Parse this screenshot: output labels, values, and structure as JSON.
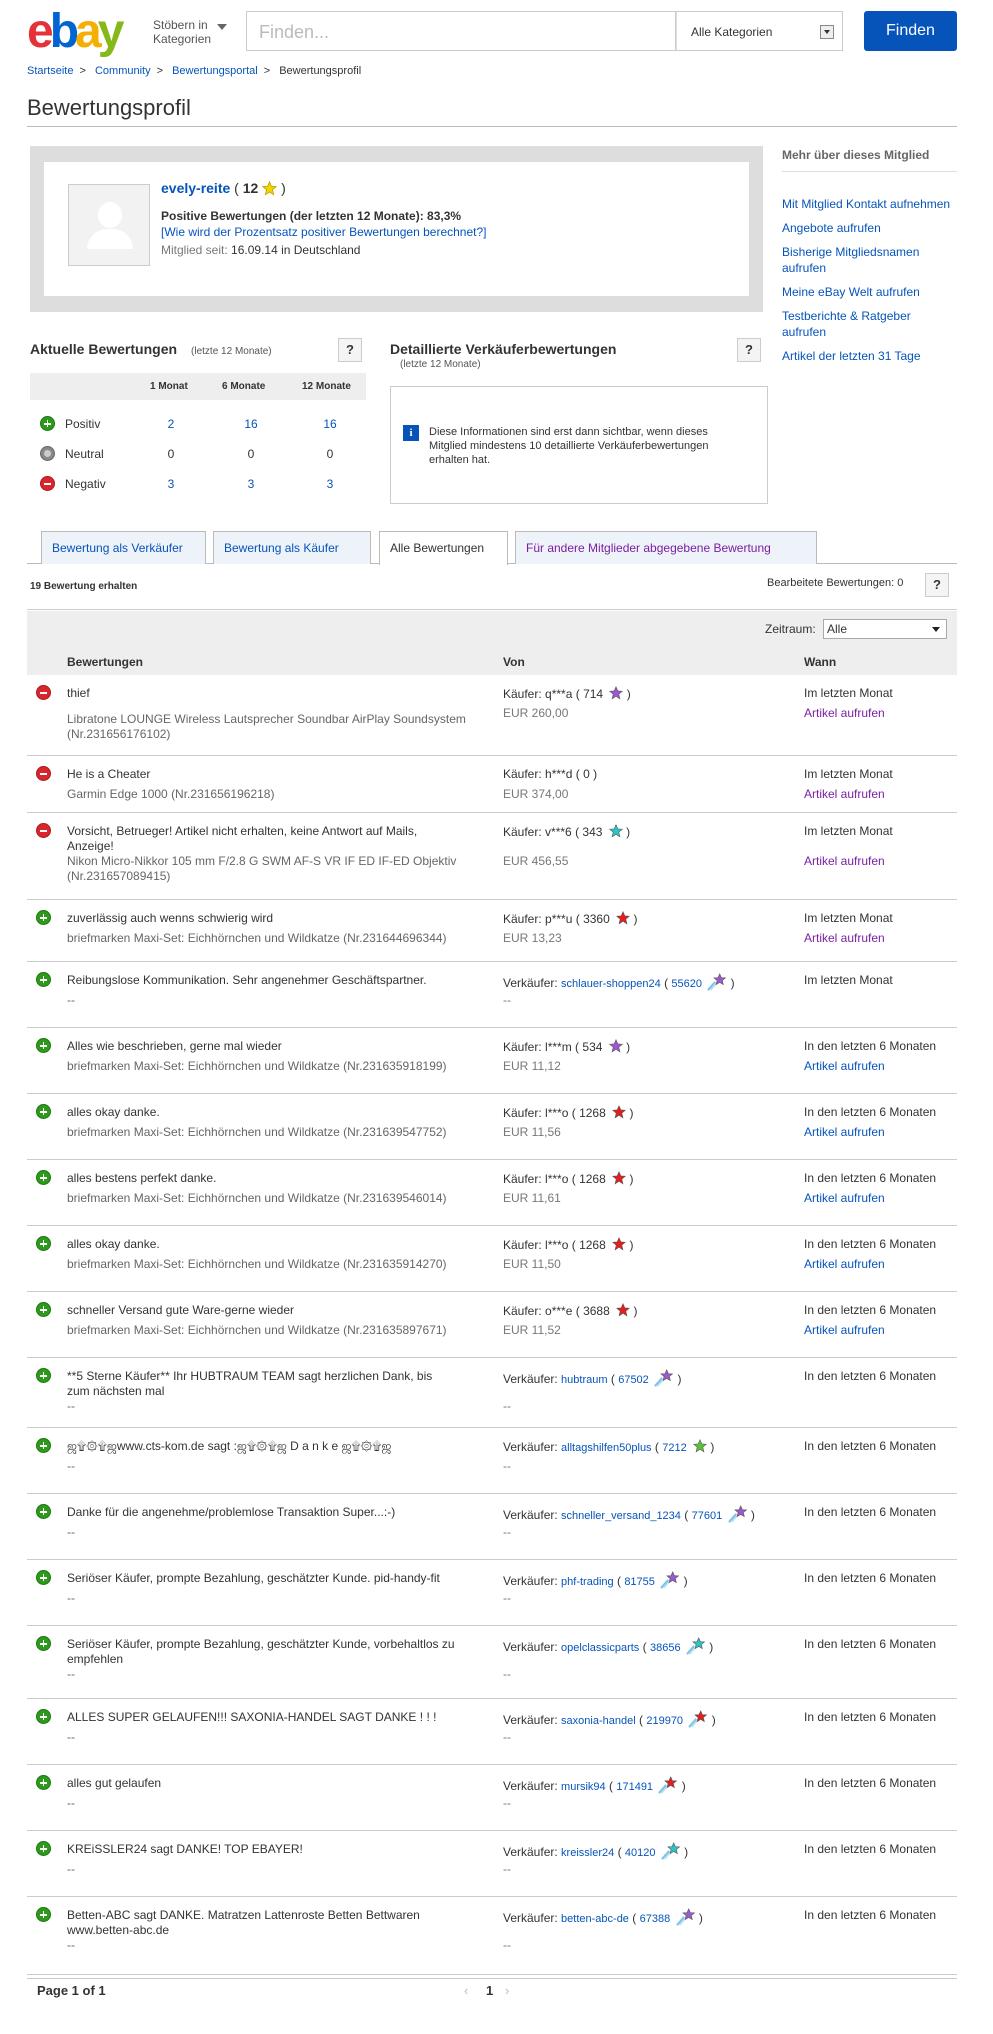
{
  "header": {
    "logo_letters": [
      "e",
      "b",
      "a",
      "y"
    ],
    "browse_line1": "Stöbern in",
    "browse_line2": "Kategorien",
    "search_placeholder": "Finden...",
    "category_select": "Alle Kategorien",
    "find_button": "Finden"
  },
  "breadcrumb": [
    "Startseite",
    "Community",
    "Bewertungsportal",
    "Bewertungsprofil"
  ],
  "page_title": "Bewertungsprofil",
  "profile": {
    "username": "evely-reite",
    "score": "12",
    "star_color": "#f5d300",
    "positive_line": "Positive Bewertungen (der letzten 12 Monate): 83,3%",
    "how_link": "[Wie wird der Prozentsatz positiver Bewertungen berechnet?]",
    "member_since_label": "Mitglied seit:",
    "member_since_value": "16.09.14 in Deutschland"
  },
  "sidebar": {
    "title": "Mehr über dieses Mitglied",
    "links": [
      "Mit Mitglied Kontakt aufnehmen",
      "Angebote aufrufen",
      "Bisherige Mitgliedsnamen aufrufen",
      "Meine eBay Welt aufrufen",
      "Testberichte & Ratgeber aufrufen",
      "Artikel der letzten 31 Tage"
    ]
  },
  "recent": {
    "title": "Aktuelle Bewertungen",
    "subtitle": "(letzte 12 Monate)",
    "help": "?",
    "columns": [
      "1 Monat",
      "6 Monate",
      "12 Monate"
    ],
    "rows": [
      {
        "label": "Positiv",
        "type": "pos",
        "values": [
          "2",
          "16",
          "16"
        ],
        "link": true
      },
      {
        "label": "Neutral",
        "type": "neu",
        "values": [
          "0",
          "0",
          "0"
        ],
        "link": false
      },
      {
        "label": "Negativ",
        "type": "neg",
        "values": [
          "3",
          "3",
          "3"
        ],
        "link": true
      }
    ]
  },
  "detailed": {
    "title": "Detaillierte Verkäuferbewertungen",
    "subtitle": "(letzte 12 Monate)",
    "help": "?",
    "info_icon": "i",
    "message": "Diese Informationen sind erst dann sichtbar, wenn dieses Mitglied mindestens 10 detaillierte Verkäuferbewertungen erhalten hat."
  },
  "tabs": [
    "Bewertung als Verkäufer",
    "Bewertung als Käufer",
    "Alle Bewertungen",
    "Für andere Mitglieder abgegebene Bewertung"
  ],
  "active_tab": "Alle Bewertungen",
  "received_count": "19 Bewertung erhalten",
  "edited": "Bearbeitete Bewertungen: 0",
  "edited_help": "?",
  "timeframe_label": "Zeitraum:",
  "timeframe_value": "Alle",
  "table_headers": [
    "Bewertungen",
    "Von",
    "Wann"
  ],
  "feedback": [
    {
      "type": "neg",
      "comment": "thief",
      "item": "Libratone LOUNGE Wireless Lautsprecher Soundbar AirPlay Soundsystem (Nr.231656176102)",
      "role": "Käufer:",
      "user": "q***a",
      "score": "714",
      "star": "#9b59d0",
      "shooting": false,
      "price": "EUR 260,00",
      "when": "Im letzten Monat",
      "article": "Artikel aufrufen",
      "article_color": "purple"
    },
    {
      "type": "neg",
      "comment": "He is a Cheater",
      "item": "Garmin Edge 1000 (Nr.231656196218)",
      "role": "Käufer:",
      "user": "h***d",
      "score": "0",
      "star": "",
      "shooting": false,
      "price": "EUR 374,00",
      "when": "Im letzten Monat",
      "article": "Artikel aufrufen",
      "article_color": "purple"
    },
    {
      "type": "neg",
      "comment": "Vorsicht, Betrueger! Artikel nicht erhalten, keine Antwort auf Mails, Anzeige!",
      "item": "Nikon Micro-Nikkor 105 mm F/2.8 G SWM AF-S VR IF ED IF-ED Objektiv (Nr.231657089415)",
      "role": "Käufer:",
      "user": "v***6",
      "score": "343",
      "star": "#2cc3c3",
      "shooting": false,
      "price": "EUR 456,55",
      "when": "Im letzten Monat",
      "article": "Artikel aufrufen",
      "article_color": "purple"
    },
    {
      "type": "pos",
      "comment": "zuverlässig auch wenns schwierig wird",
      "item": "briefmarken Maxi-Set: Eichhörnchen und Wildkatze (Nr.231644696344)",
      "role": "Käufer:",
      "user": "p***u",
      "score": "3360",
      "star": "#e02020",
      "shooting": false,
      "price": "EUR 13,23",
      "when": "Im letzten Monat",
      "article": "Artikel aufrufen",
      "article_color": "purple"
    },
    {
      "type": "pos",
      "comment": "Reibungslose Kommunikation. Sehr angenehmer Geschäftspartner.",
      "item": "--",
      "role": "Verkäufer:",
      "user": "schlauer-shoppen24",
      "score": "55620",
      "star": "#9b59d0",
      "shooting": true,
      "price": "--",
      "when": "Im letzten Monat",
      "article": "",
      "article_color": "blue"
    },
    {
      "type": "pos",
      "comment": "Alles wie beschrieben, gerne mal wieder",
      "item": "briefmarken Maxi-Set: Eichhörnchen und Wildkatze (Nr.231635918199)",
      "role": "Käufer:",
      "user": "l***m",
      "score": "534",
      "star": "#9b59d0",
      "shooting": false,
      "price": "EUR 11,12",
      "when": "In den letzten 6 Monaten",
      "article": "Artikel aufrufen",
      "article_color": "blue"
    },
    {
      "type": "pos",
      "comment": "alles okay danke.",
      "item": "briefmarken Maxi-Set: Eichhörnchen und Wildkatze (Nr.231639547752)",
      "role": "Käufer:",
      "user": "l***o",
      "score": "1268",
      "star": "#e02020",
      "shooting": false,
      "price": "EUR 11,56",
      "when": "In den letzten 6 Monaten",
      "article": "Artikel aufrufen",
      "article_color": "blue"
    },
    {
      "type": "pos",
      "comment": "alles bestens perfekt danke.",
      "item": "briefmarken Maxi-Set: Eichhörnchen und Wildkatze (Nr.231639546014)",
      "role": "Käufer:",
      "user": "l***o",
      "score": "1268",
      "star": "#e02020",
      "shooting": false,
      "price": "EUR 11,61",
      "when": "In den letzten 6 Monaten",
      "article": "Artikel aufrufen",
      "article_color": "blue"
    },
    {
      "type": "pos",
      "comment": "alles okay danke.",
      "item": "briefmarken Maxi-Set: Eichhörnchen und Wildkatze (Nr.231635914270)",
      "role": "Käufer:",
      "user": "l***o",
      "score": "1268",
      "star": "#e02020",
      "shooting": false,
      "price": "EUR 11,50",
      "when": "In den letzten 6 Monaten",
      "article": "Artikel aufrufen",
      "article_color": "blue"
    },
    {
      "type": "pos",
      "comment": "schneller Versand gute Ware-gerne wieder",
      "item": "briefmarken Maxi-Set: Eichhörnchen und Wildkatze (Nr.231635897671)",
      "role": "Käufer:",
      "user": "o***e",
      "score": "3688",
      "star": "#e02020",
      "shooting": false,
      "price": "EUR 11,52",
      "when": "In den letzten 6 Monaten",
      "article": "Artikel aufrufen",
      "article_color": "blue"
    },
    {
      "type": "pos",
      "comment": "**5 Sterne Käufer** Ihr HUBTRAUM TEAM sagt herzlichen Dank, bis zum nächsten mal",
      "item": "--",
      "role": "Verkäufer:",
      "user": "hubtraum",
      "score": "67502",
      "star": "#9b59d0",
      "shooting": true,
      "price": "--",
      "when": "In den letzten 6 Monaten",
      "article": "",
      "article_color": "blue"
    },
    {
      "type": "pos",
      "comment": "ஜ۩۞۩ஜwww.cts-kom.de sagt :ஜ۩۞۩ஜ D a n k e ஜ۩۞۩ஜ",
      "item": "--",
      "role": "Verkäufer:",
      "user": "alltagshilfen50plus",
      "score": "7212",
      "star": "#5bc236",
      "shooting": false,
      "price": "--",
      "when": "In den letzten 6 Monaten",
      "article": "",
      "article_color": "blue"
    },
    {
      "type": "pos",
      "comment": "Danke für die angenehme/problemlose Transaktion Super...:-)",
      "item": "--",
      "role": "Verkäufer:",
      "user": "schneller_versand_1234",
      "score": "77601",
      "star": "#9b59d0",
      "shooting": true,
      "price": "--",
      "when": "In den letzten 6 Monaten",
      "article": "",
      "article_color": "blue"
    },
    {
      "type": "pos",
      "comment": "Seriöser Käufer, prompte Bezahlung, geschätzter Kunde. pid-handy-fit",
      "item": "--",
      "role": "Verkäufer:",
      "user": "phf-trading",
      "score": "81755",
      "star": "#9b59d0",
      "shooting": true,
      "price": "--",
      "when": "In den letzten 6 Monaten",
      "article": "",
      "article_color": "blue"
    },
    {
      "type": "pos",
      "comment": "Seriöser Käufer, prompte Bezahlung, geschätzter Kunde, vorbehaltlos zu empfehlen",
      "item": "--",
      "role": "Verkäufer:",
      "user": "opelclassicparts",
      "score": "38656",
      "star": "#2cc3c3",
      "shooting": true,
      "price": "--",
      "when": "In den letzten 6 Monaten",
      "article": "",
      "article_color": "blue"
    },
    {
      "type": "pos",
      "comment": "ALLES SUPER GELAUFEN!!! SAXONIA-HANDEL SAGT DANKE ! ! !",
      "item": "--",
      "role": "Verkäufer:",
      "user": "saxonia-handel",
      "score": "219970",
      "star": "#e02020",
      "shooting": true,
      "price": "--",
      "when": "In den letzten 6 Monaten",
      "article": "",
      "article_color": "blue"
    },
    {
      "type": "pos",
      "comment": "alles gut gelaufen",
      "item": "--",
      "role": "Verkäufer:",
      "user": "mursik94",
      "score": "171491",
      "star": "#e02020",
      "shooting": true,
      "price": "--",
      "when": "In den letzten 6 Monaten",
      "article": "",
      "article_color": "blue"
    },
    {
      "type": "pos",
      "comment": "KREiSSLER24 sagt DANKE! TOP EBAYER!",
      "item": "--",
      "role": "Verkäufer:",
      "user": "kreissler24",
      "score": "40120",
      "star": "#2cc3c3",
      "shooting": true,
      "price": "--",
      "when": "In den letzten 6 Monaten",
      "article": "",
      "article_color": "blue"
    },
    {
      "type": "pos",
      "comment": "Betten-ABC sagt DANKE. Matratzen Lattenroste Betten Bettwaren www.betten-abc.de",
      "item": "--",
      "role": "Verkäufer:",
      "user": "betten-abc-de",
      "score": "67388",
      "star": "#9b59d0",
      "shooting": true,
      "price": "--",
      "when": "In den letzten 6 Monaten",
      "article": "",
      "article_color": "blue"
    }
  ],
  "pager": {
    "label": "Page 1 of 1",
    "current": "1",
    "prev": "‹",
    "next": "›"
  }
}
